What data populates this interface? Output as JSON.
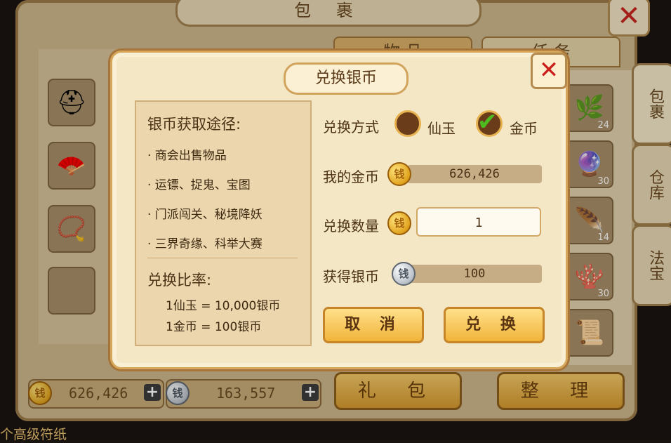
{
  "background": {
    "title": "包 裹",
    "close_glyph": "✕",
    "top_tabs": [
      "物 品",
      "任 务"
    ],
    "side_tabs": [
      "包裹",
      "仓库",
      "法宝"
    ],
    "gold_amount": "626,426",
    "silver_amount": "163,557",
    "plus_glyph": "+",
    "buttons": {
      "gift": "礼 包",
      "arrange": "整 理"
    },
    "stack_counts": [
      "24",
      "30",
      "14",
      "30"
    ],
    "chat_text": "个高级符纸"
  },
  "modal": {
    "title": "兑换银币",
    "close_glyph": "✕",
    "info": {
      "heading": "银币获取途径:",
      "ways": [
        "· 商会出售物品",
        "· 运镖、捉鬼、宝图",
        "· 门派闯关、秘境降妖",
        "· 三界奇缘、科举大赛"
      ],
      "rate_heading": "兑换比率:",
      "rates": [
        "1仙玉 = 10,000银币",
        "1金币 = 100银币"
      ]
    },
    "method_label": "兑换方式",
    "option_xianyu": "仙玉",
    "option_gold": "金币",
    "selected_option": "金币",
    "my_gold_label": "我的金币",
    "my_gold_value": "626,426",
    "quantity_label": "兑换数量",
    "quantity_value": "1",
    "obtain_label": "获得银币",
    "obtain_value": "100",
    "cancel_label": "取 消",
    "confirm_label": "兑 换"
  },
  "colors": {
    "accent_gold": "#f1b43a",
    "close_red": "#c9201b",
    "check_green": "#4dbb1f"
  },
  "icons": {
    "gold_coin": "gold-coin-icon",
    "silver_coin": "silver-coin-icon",
    "check": "check-icon",
    "close": "close-icon"
  }
}
